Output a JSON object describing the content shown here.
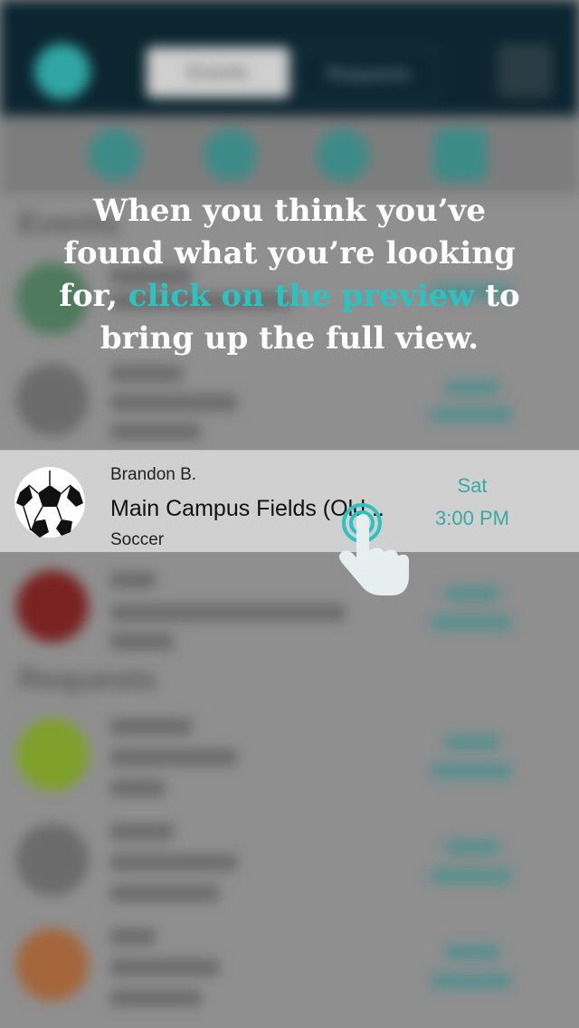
{
  "header": {
    "segment_left": "Events",
    "segment_right": "Requests"
  },
  "sections": {
    "upcoming": "Events",
    "requests": "Requests"
  },
  "instruction": {
    "line1": "When you think you’ve",
    "line2": "found what you’re looking",
    "line3_before": "for, ",
    "line3_highlight": "click on the preview",
    "line3_after": " to",
    "line4": "bring up the full view."
  },
  "highlighted_event": {
    "user": "Brandon B.",
    "location": "Main Campus Fields (Old...",
    "sport": "Soccer",
    "day": "Sat",
    "time": "3:00 PM"
  },
  "colors": {
    "accent": "#2cc2c0",
    "time_text": "#3aa8a3",
    "topbar": "#0c2530"
  }
}
